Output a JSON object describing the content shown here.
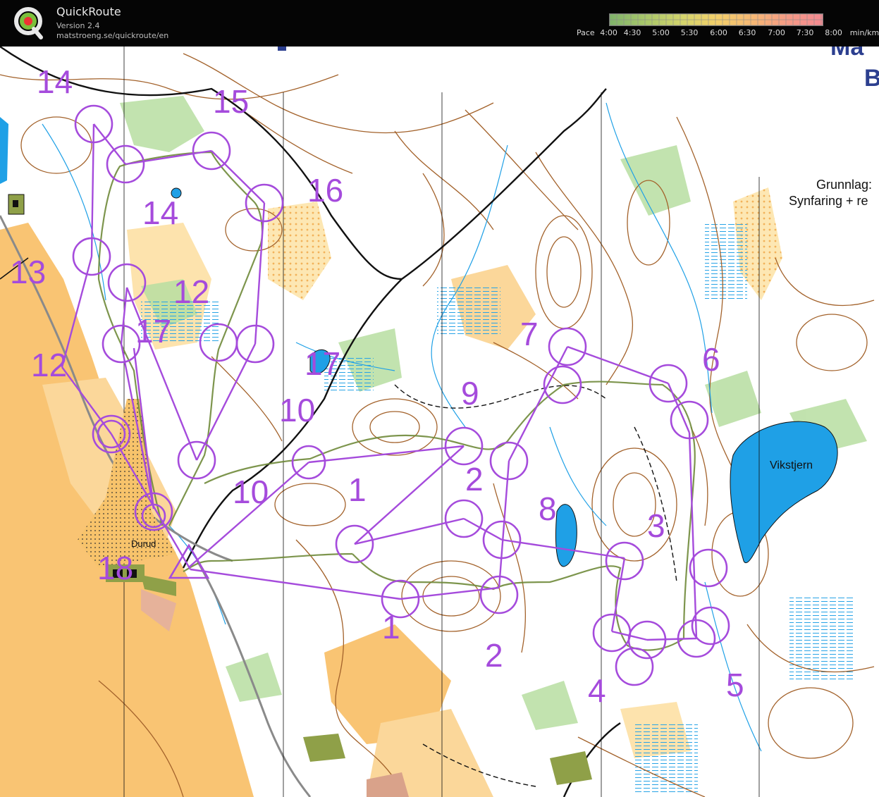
{
  "app": {
    "name": "QuickRoute",
    "version": "Version 2.4",
    "url": "matstroeng.se/quickroute/en"
  },
  "pace_legend": {
    "prefix": "Pace",
    "ticks": [
      "4:00",
      "4:30",
      "5:00",
      "5:30",
      "6:00",
      "6:30",
      "7:00",
      "7:30",
      "8:00"
    ],
    "unit": "min/km",
    "colors": [
      "#7fb36a",
      "#a9c76a",
      "#d4d56c",
      "#f3d06a",
      "#f6b874",
      "#f59a86",
      "#f58a92"
    ]
  },
  "map": {
    "lake_label": "Vikstjern",
    "farm_label": "Durud",
    "info_line1": "Grunnlag:",
    "info_line2": "Synfaring + re",
    "title_fragment1": "Ma",
    "title_fragment2": "B",
    "colors": {
      "course": "#a54bdc",
      "route": "#6f8a3a",
      "contour": "#a3622b",
      "water": "#1fa0e6",
      "open": "#f9c473",
      "green": "#b7dea1"
    },
    "control_numbers": [
      "1",
      "1",
      "2",
      "2",
      "3",
      "4",
      "5",
      "6",
      "7",
      "8",
      "9",
      "10",
      "10",
      "12",
      "12",
      "13",
      "14",
      "14",
      "15",
      "16",
      "17",
      "17",
      "18"
    ]
  }
}
